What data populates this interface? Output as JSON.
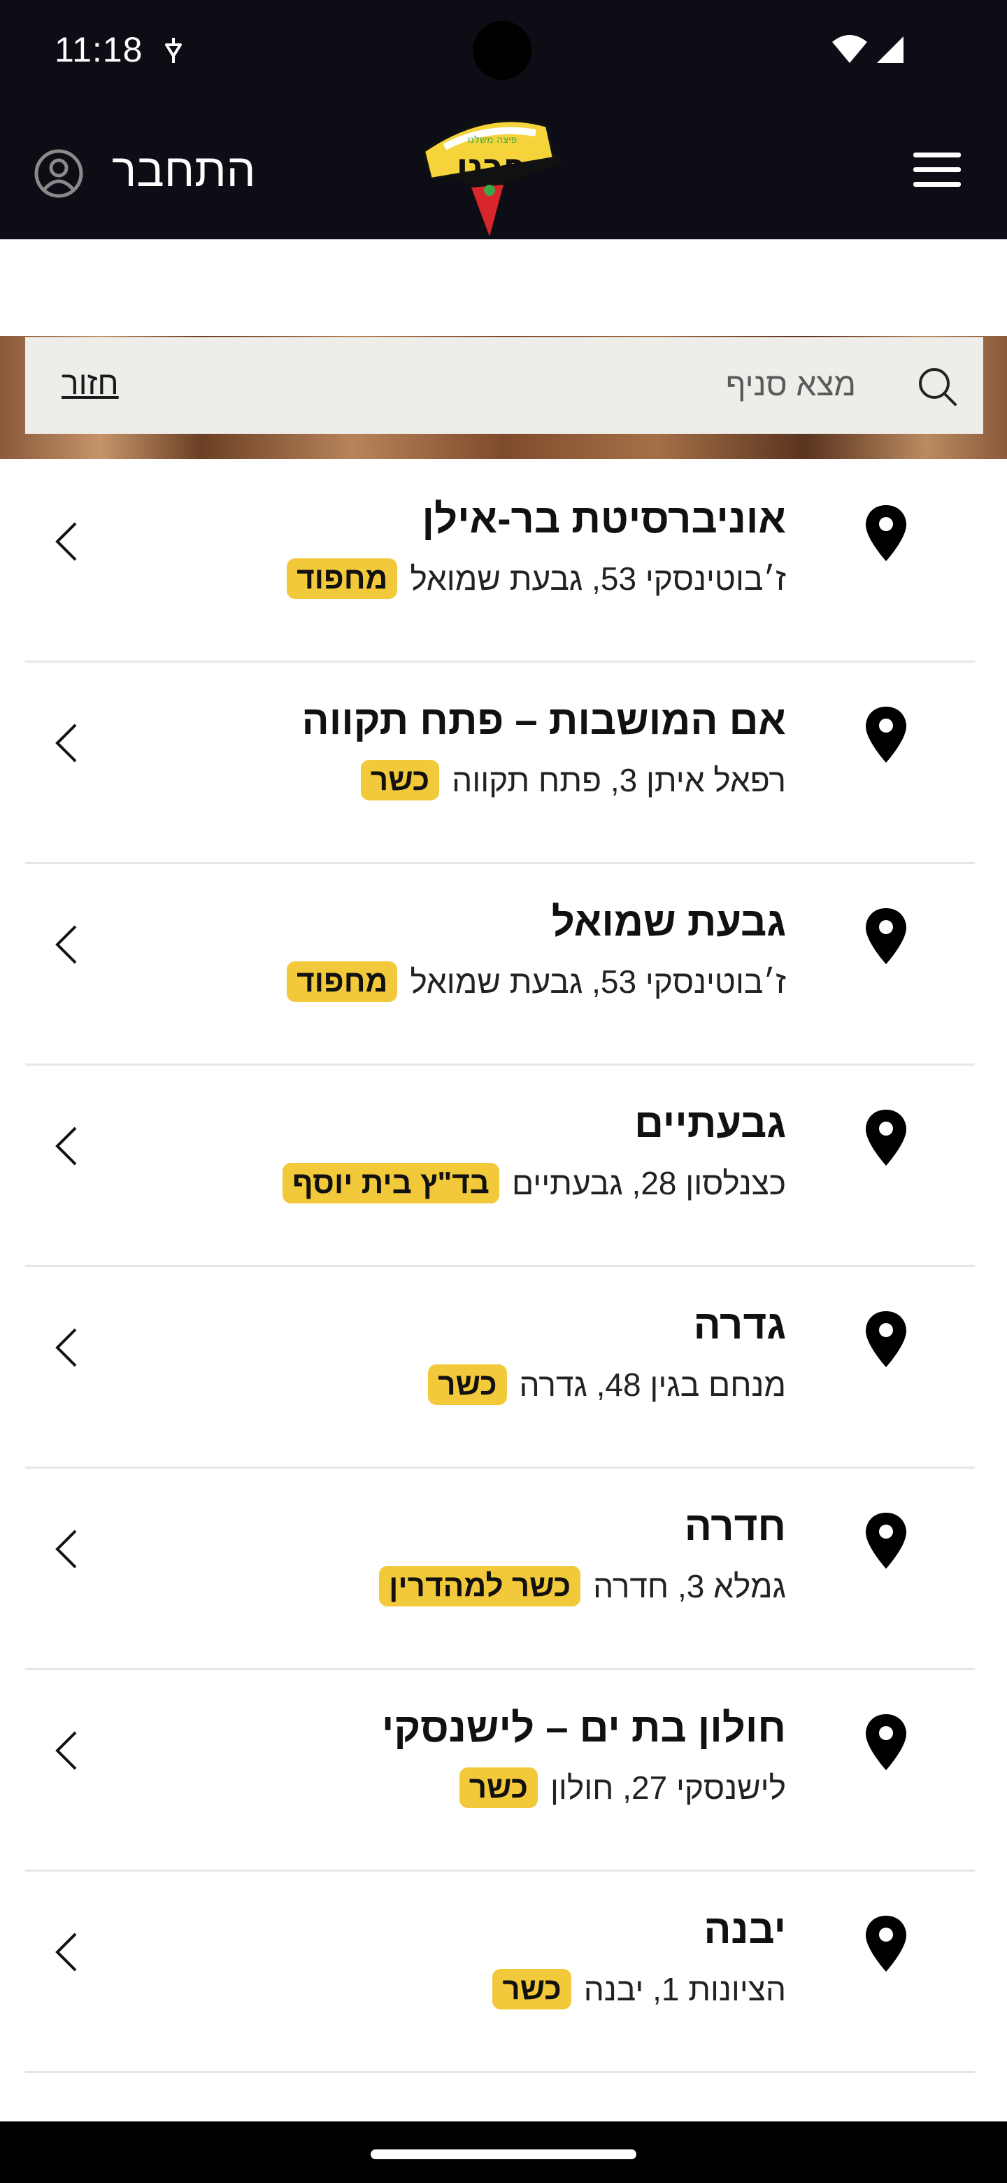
{
  "status_bar": {
    "time": "11:18"
  },
  "header": {
    "login_label": "התחבר",
    "logo_text": "פרגו",
    "logo_tagline": "פיצה משלנו"
  },
  "search": {
    "placeholder": "מצא סניף",
    "back_label": "חזור"
  },
  "branches": [
    {
      "name": "אוניברסיטת בר-אילן",
      "address": "ז׳בוטינסקי 53, גבעת שמואל",
      "badge": "מחפוד"
    },
    {
      "name": "אם המושבות – פתח תקווה",
      "address": "רפאל איתן 3, פתח תקווה",
      "badge": "כשר"
    },
    {
      "name": "גבעת שמואל",
      "address": "ז׳בוטינסקי 53, גבעת שמואל",
      "badge": "מחפוד"
    },
    {
      "name": "גבעתיים",
      "address": "כצנלסון 28, גבעתיים",
      "badge": "בד\"ץ בית יוסף"
    },
    {
      "name": "גדרה",
      "address": "מנחם בגין 48, גדרה",
      "badge": "כשר"
    },
    {
      "name": "חדרה",
      "address": "גמלא 3, חדרה",
      "badge": "כשר למהדרין"
    },
    {
      "name": "חולון בת ים – לישנסקי",
      "address": "לישנסקי 27, חולון",
      "badge": "כשר"
    },
    {
      "name": "יבנה",
      "address": "הציונות 1, יבנה",
      "badge": "כשר"
    }
  ],
  "colors": {
    "header_bg": "#0d0d15",
    "badge_bg": "#f2c93a",
    "logo_yellow": "#f5d33a",
    "logo_red": "#d9262c"
  }
}
